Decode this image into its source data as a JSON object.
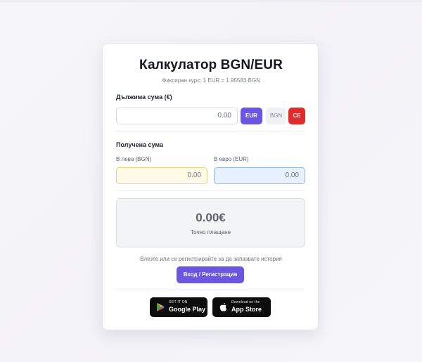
{
  "title": "Калкулатор BGN/EUR",
  "rate_text": "Фиксиран курс: 1 EUR = 1.95583 BGN",
  "due": {
    "label": "Дължима сума (€)",
    "value": "0.00",
    "currency_buttons": [
      "EUR",
      "BGN",
      "CE"
    ]
  },
  "received": {
    "label": "Получена сума",
    "bgn_label": "В лева (BGN)",
    "bgn_value": "0.00",
    "eur_label": "В евро (EUR)",
    "eur_value": "0.00"
  },
  "result": {
    "amount": "0.00€",
    "caption": "Точно плащане"
  },
  "auth": {
    "hint": "Влезте или се регистрирайте за да запазвате история",
    "button_label": "Вход / Регистрация"
  },
  "stores": {
    "google_play": {
      "small": "GET IT ON",
      "big": "Google Play",
      "icon": "google-play-icon"
    },
    "app_store": {
      "small": "Download on the",
      "big": "App Store",
      "icon": "apple-icon"
    }
  },
  "colors": {
    "accent": "#6c55e2",
    "danger": "#e22b2b",
    "bgn_field_bg": "#fffbe8",
    "eur_field_bg": "#e7f1ff"
  }
}
